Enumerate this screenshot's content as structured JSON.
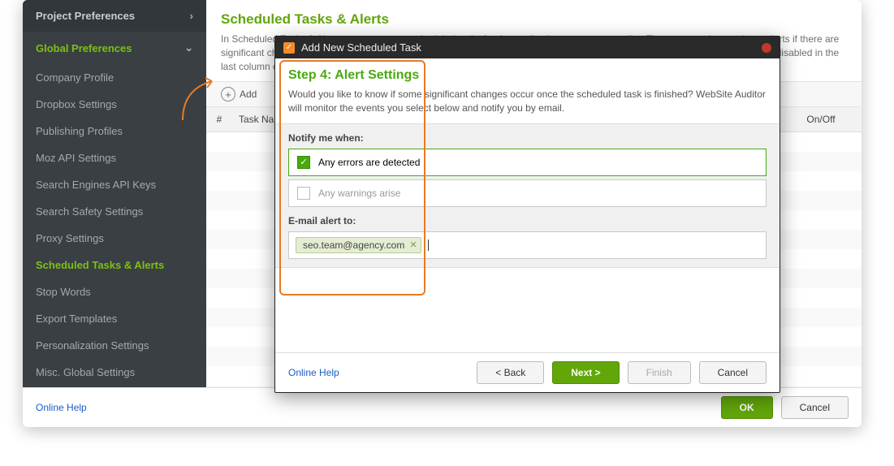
{
  "sidebar": {
    "project_prefs": "Project Preferences",
    "global_prefs": "Global Preferences",
    "items": [
      "Company Profile",
      "Dropbox Settings",
      "Publishing Profiles",
      "Moz API Settings",
      "Search Engines API Keys",
      "Search Safety Settings",
      "Proxy Settings",
      "Scheduled Tasks & Alerts",
      "Stop Words",
      "Export Templates",
      "Personalization Settings",
      "Misc. Global Settings"
    ],
    "active_index": 7
  },
  "main": {
    "title": "Scheduled Tasks & Alerts",
    "description": "In Scheduled Tasks & Alerts you can create scheduled tasks for the application to run on autopilot. The app can also send you alerts if there are significant changes since the last check. Click Add to add a new task, or Edit to change existing ones. Alerts can be enabled and disabled in the last column of the grid.",
    "add_label": "Add",
    "col_num": "#",
    "col_name": "Task Name",
    "col_onoff": "On/Off"
  },
  "footer": {
    "help": "Online Help",
    "ok": "OK",
    "cancel": "Cancel"
  },
  "modal": {
    "title": "Add New Scheduled Task",
    "step_title": "Step 4: Alert Settings",
    "step_desc": "Would you like to know if some significant changes occur once the scheduled task is finished? WebSite Auditor will monitor the events you select below and notify you by email.",
    "notify_label": "Notify me when:",
    "check1": "Any errors are detected",
    "check2": "Any warnings arise",
    "email_label": "E-mail alert to:",
    "email_value": "seo.team@agency.com",
    "help": "Online Help",
    "back": "< Back",
    "next": "Next >",
    "finish": "Finish",
    "cancel": "Cancel"
  }
}
